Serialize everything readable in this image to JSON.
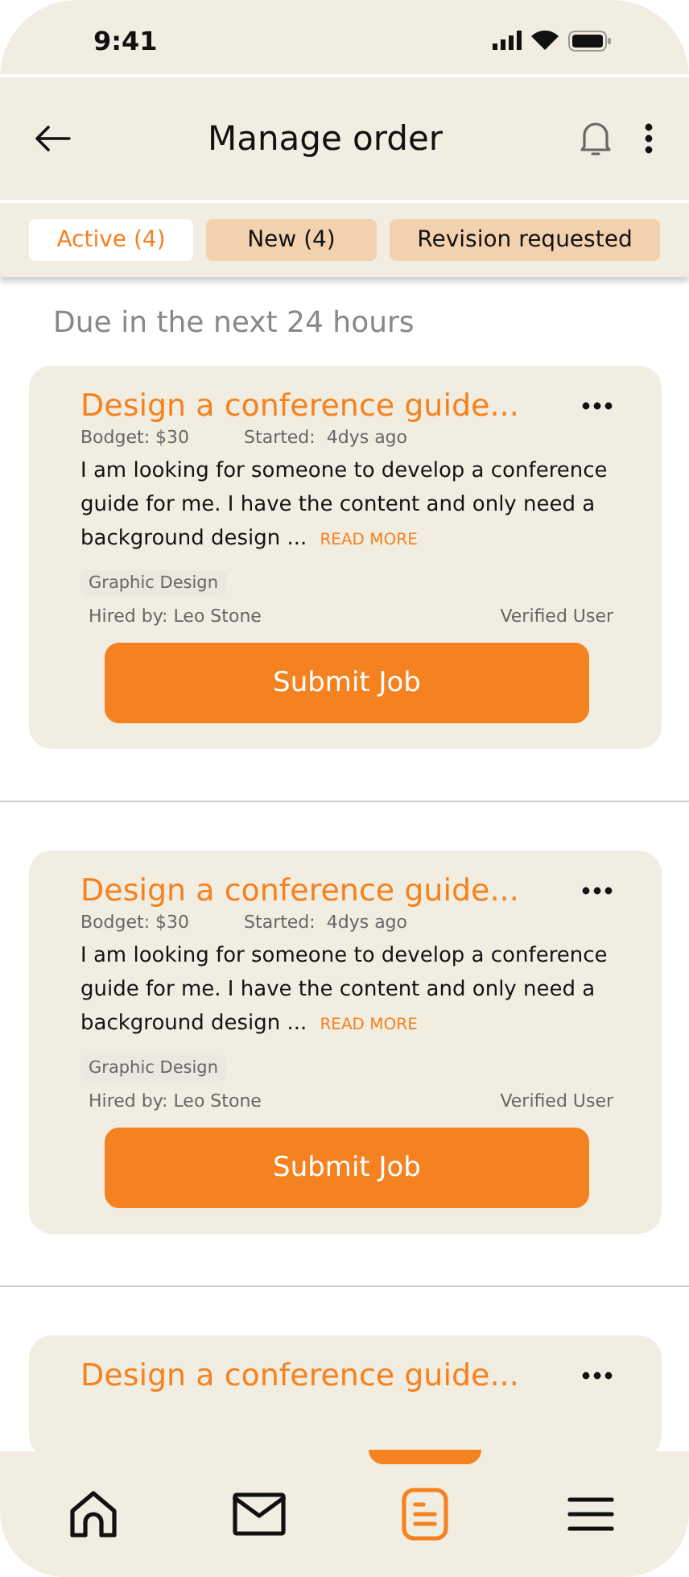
{
  "status_bar": {
    "time": "9:41"
  },
  "header": {
    "title": "Manage order"
  },
  "tabs": [
    {
      "label": "Active (4)",
      "selected": true
    },
    {
      "label": "New (4)",
      "selected": false
    },
    {
      "label": "Revision requested",
      "selected": false
    }
  ],
  "section_title": "Due in the next 24 hours",
  "orders": [
    {
      "kind": "full",
      "title": "Design a conference guide...",
      "budget": "Bodget: $30",
      "started": "Started:  4dys ago",
      "description": "I am looking for someone to develop a conference guide for me. I have the content and only need a background design ...",
      "read_more": "READ MORE",
      "tag": "Graphic Design",
      "hired_by": "Hired by: Leo Stone",
      "verified": "Verified User",
      "button": "Submit Job"
    },
    {
      "kind": "full",
      "title": "Design a conference guide...",
      "budget": "Bodget: $30",
      "started": "Started:  4dys ago",
      "description": "I am looking for someone to develop a conference guide for me. I have the content and only need a background design ...",
      "read_more": "READ MORE",
      "tag": "Graphic Design",
      "hired_by": "Hired by: Leo Stone",
      "verified": "Verified User",
      "button": "Submit Job"
    },
    {
      "kind": "partial",
      "title": "Design a conference guide..."
    }
  ],
  "bottom_nav": [
    {
      "kind": "home",
      "selected": false
    },
    {
      "kind": "mail",
      "selected": false
    },
    {
      "kind": "orders",
      "selected": true
    },
    {
      "kind": "menu",
      "selected": false
    }
  ]
}
